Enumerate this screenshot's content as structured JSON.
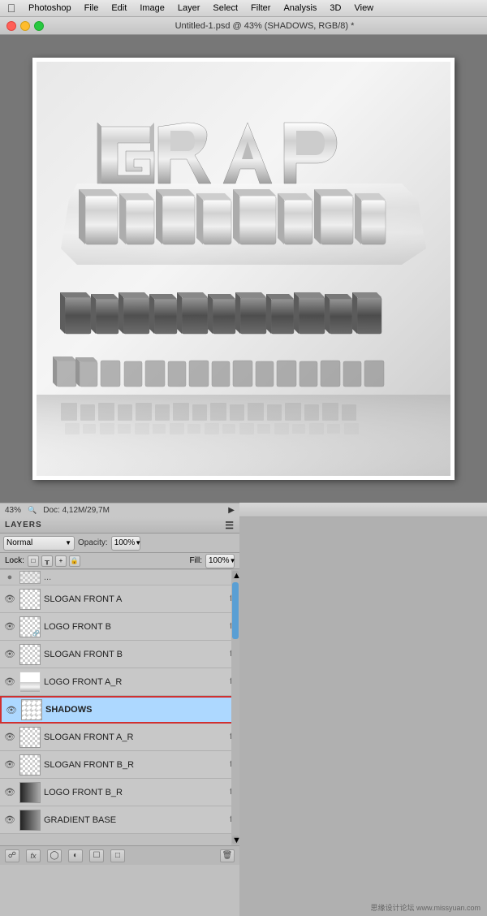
{
  "menubar": {
    "items": [
      "Photoshop",
      "File",
      "Edit",
      "Image",
      "Layer",
      "Select",
      "Filter",
      "Analysis",
      "3D",
      "View"
    ]
  },
  "titlebar": {
    "title": "Untitled-1.psd @ 43% (SHADOWS, RGB/8) *"
  },
  "statusbar": {
    "zoom": "43%",
    "doc_info": "Doc: 4,12M/29,7M",
    "arrow": "▶"
  },
  "layers_panel": {
    "title": "LAYERS",
    "blend_mode": "Normal",
    "opacity_label": "Opacity:",
    "opacity_value": "100%",
    "lock_label": "Lock:",
    "fill_label": "Fill:",
    "fill_value": "100%",
    "layers": [
      {
        "name": "SLOGAN FRONT A",
        "thumb_type": "checkered",
        "has_fx": true,
        "visible": true,
        "active": false,
        "border": false
      },
      {
        "name": "LOGO FRONT B",
        "thumb_type": "checkered_link",
        "has_fx": true,
        "visible": true,
        "active": false,
        "border": false
      },
      {
        "name": "SLOGAN FRONT B",
        "thumb_type": "checkered",
        "has_fx": true,
        "visible": true,
        "active": false,
        "border": false
      },
      {
        "name": "LOGO FRONT A_R",
        "thumb_type": "white_link",
        "has_fx": true,
        "visible": true,
        "active": false,
        "border": false
      },
      {
        "name": "SHADOWS",
        "thumb_type": "checkered_diag",
        "has_fx": false,
        "visible": true,
        "active": true,
        "border": true
      },
      {
        "name": "SLOGAN FRONT A_R",
        "thumb_type": "checkered",
        "has_fx": true,
        "visible": true,
        "active": false,
        "border": false
      },
      {
        "name": "SLOGAN FRONT B_R",
        "thumb_type": "checkered",
        "has_fx": true,
        "visible": true,
        "active": false,
        "border": false
      },
      {
        "name": "LOGO FRONT B_R",
        "thumb_type": "dark_gradient",
        "has_fx": true,
        "visible": true,
        "active": false,
        "border": false
      },
      {
        "name": "GRADIENT BASE",
        "thumb_type": "gradient_thumb",
        "has_fx": true,
        "visible": true,
        "active": false,
        "border": false
      }
    ],
    "toolbar_icons": [
      "link",
      "fx",
      "circle",
      "folder",
      "adjust",
      "trash"
    ]
  },
  "watermark": "思缘设计论坛 www.missyuan.com"
}
